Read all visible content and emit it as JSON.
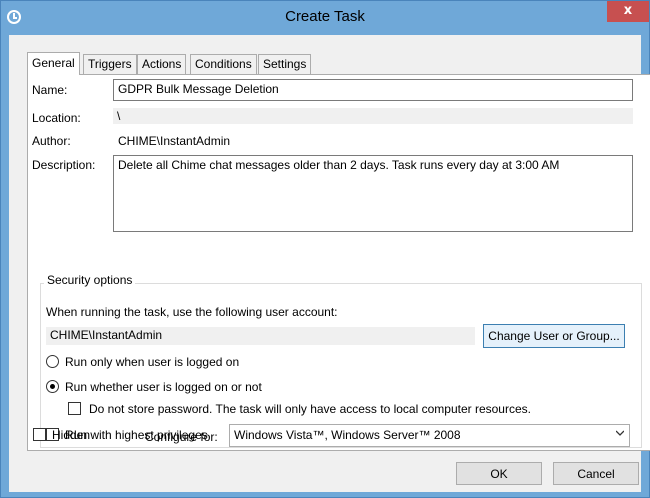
{
  "window": {
    "title": "Create Task",
    "close_label": "x"
  },
  "tabs": [
    {
      "label": "General"
    },
    {
      "label": "Triggers"
    },
    {
      "label": "Actions"
    },
    {
      "label": "Conditions"
    },
    {
      "label": "Settings"
    }
  ],
  "general": {
    "name_label": "Name:",
    "name_value": "GDPR Bulk Message Deletion",
    "location_label": "Location:",
    "location_value": "\\",
    "author_label": "Author:",
    "author_value": "CHIME\\InstantAdmin",
    "description_label": "Description:",
    "description_value": "Delete all Chime chat messages older than 2 days. Task runs every day at 3:00 AM"
  },
  "security": {
    "group_title": "Security options",
    "account_prompt": "When running the task, use the following user account:",
    "account_value": "CHIME\\InstantAdmin",
    "change_button": "Change User or Group...",
    "radio_logged_on": "Run only when user is logged on",
    "radio_whether": "Run whether user is logged on or not",
    "no_store_password": "Do not store password.  The task will only have access to local computer resources.",
    "highest_privileges": "Run with highest privileges"
  },
  "bottom": {
    "hidden_label": "Hidden",
    "configure_label": "Configure for:",
    "configure_value": "Windows Vista™, Windows Server™ 2008"
  },
  "buttons": {
    "ok": "OK",
    "cancel": "Cancel"
  },
  "colors": {
    "title_bar": "#6fa8d8",
    "close_button": "#c75050"
  }
}
